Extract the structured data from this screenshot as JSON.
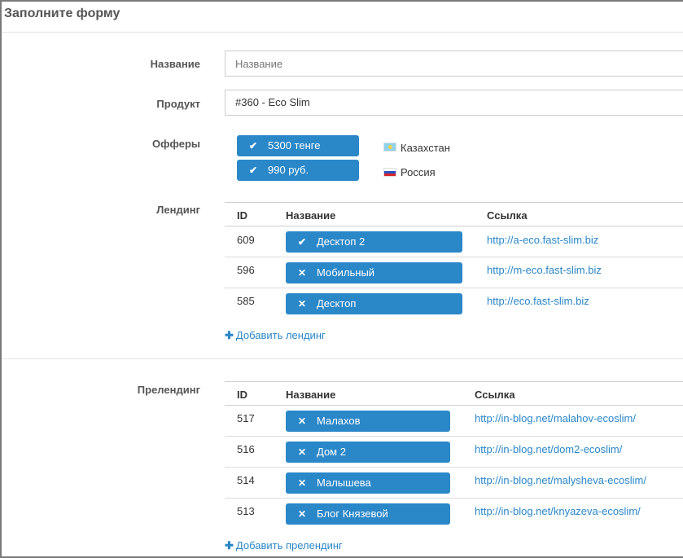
{
  "form": {
    "title": "Заполните форму"
  },
  "fields": {
    "name": {
      "label": "Название",
      "placeholder": "Название",
      "value": ""
    },
    "product": {
      "label": "Продукт",
      "value": "#360 - Eco Slim"
    },
    "offers": {
      "label": "Офферы",
      "items": [
        {
          "label": "5300 тенге",
          "country": "Казахстан",
          "icon": "check-icon",
          "flag": "kazakhstan-flag-icon"
        },
        {
          "label": "990 руб.",
          "country": "Россия",
          "icon": "check-icon",
          "flag": "russia-flag-icon"
        }
      ]
    },
    "landing": {
      "label": "Лендинг",
      "columns": {
        "id": "ID",
        "name": "Название",
        "link": "Ссылка"
      },
      "rows": [
        {
          "id": "609",
          "name": "Десктоп 2",
          "icon": "check-icon",
          "url": "http://a-eco.fast-slim.biz"
        },
        {
          "id": "596",
          "name": "Мобильный",
          "icon": "x-icon",
          "url": "http://m-eco.fast-slim.biz"
        },
        {
          "id": "585",
          "name": "Десктоп",
          "icon": "x-icon",
          "url": "http://eco.fast-slim.biz"
        }
      ],
      "add_label": "Добавить лендинг"
    },
    "prelanding": {
      "label": "Прелендинг",
      "columns": {
        "id": "ID",
        "name": "Название",
        "link": "Ссылка"
      },
      "rows": [
        {
          "id": "517",
          "name": "Малахов",
          "icon": "x-icon",
          "url": "http://in-blog.net/malahov-ecoslim/"
        },
        {
          "id": "516",
          "name": "Дом 2",
          "icon": "x-icon",
          "url": "http://in-blog.net/dom2-ecoslim/"
        },
        {
          "id": "514",
          "name": "Малышева",
          "icon": "x-icon",
          "url": "http://in-blog.net/malysheva-ecoslim/"
        },
        {
          "id": "513",
          "name": "Блог Князевой",
          "icon": "x-icon",
          "url": "http://in-blog.net/knyazeva-ecoslim/"
        }
      ],
      "add_label": "Добавить прелендинг"
    }
  },
  "colors": {
    "accent": "#2a87c8",
    "text": "#333333",
    "label": "#555555"
  }
}
